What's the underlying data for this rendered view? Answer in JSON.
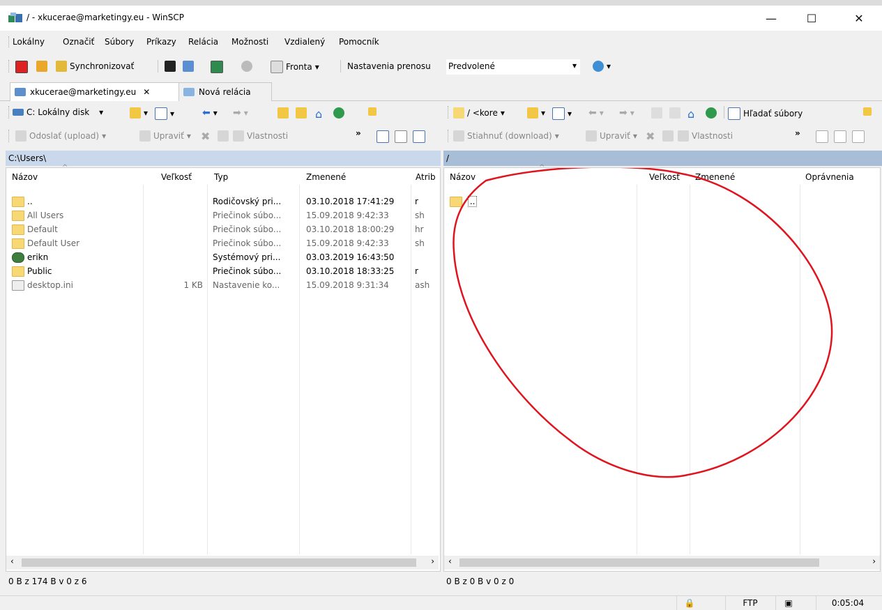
{
  "window": {
    "title": "/ - xkucerae@marketingy.eu - WinSCP",
    "minimize": "—",
    "maximize": "☐",
    "close": "✕"
  },
  "menu": [
    "Lokálny",
    "Označiť",
    "Súbory",
    "Príkazy",
    "Relácia",
    "Možnosti",
    "Vzdialený",
    "Pomocník"
  ],
  "toolbar": {
    "synchronize": "Synchronizovať",
    "queue": "Fronta",
    "transfer_label": "Nastavenia prenosu",
    "transfer_value": "Predvolené"
  },
  "tabs": [
    {
      "label": "xkucerae@marketingy.eu",
      "close": "✕"
    },
    {
      "label": "Nová relácia"
    }
  ],
  "local": {
    "drive": "C: Lokálny disk",
    "upload": "Odoslať (upload)",
    "edit": "Upraviť",
    "properties": "Vlastnosti",
    "path": "C:\\Users\\",
    "columns": [
      "Názov",
      "Veľkosť",
      "Typ",
      "Zmenené",
      "Atrib"
    ],
    "rows": [
      {
        "name": "..",
        "size": "",
        "type": "Rodičovský pri...",
        "changed": "03.10.2018 17:41:29",
        "attr": "r",
        "kind": "parent",
        "gray": false
      },
      {
        "name": "All Users",
        "size": "",
        "type": "Priečinok súbo...",
        "changed": "15.09.2018 9:42:33",
        "attr": "sh",
        "kind": "folder",
        "gray": true
      },
      {
        "name": "Default",
        "size": "",
        "type": "Priečinok súbo...",
        "changed": "03.10.2018 18:00:29",
        "attr": "hr",
        "kind": "folder",
        "gray": true
      },
      {
        "name": "Default User",
        "size": "",
        "type": "Priečinok súbo...",
        "changed": "15.09.2018 9:42:33",
        "attr": "sh",
        "kind": "folder",
        "gray": true
      },
      {
        "name": "erikn",
        "size": "",
        "type": "Systémový pri...",
        "changed": "03.03.2019 16:43:50",
        "attr": "",
        "kind": "user",
        "gray": false
      },
      {
        "name": "Public",
        "size": "",
        "type": "Priečinok súbo...",
        "changed": "03.10.2018 18:33:25",
        "attr": "r",
        "kind": "folder",
        "gray": false
      },
      {
        "name": "desktop.ini",
        "size": "1 KB",
        "type": "Nastavenie ko...",
        "changed": "15.09.2018 9:31:34",
        "attr": "ash",
        "kind": "file",
        "gray": true
      }
    ],
    "status": "0 B z 174 B v 0 z 6"
  },
  "remote": {
    "path_combo": "/ <kore",
    "find": "Hľadať súbory",
    "download": "Stiahnuť (download)",
    "edit": "Upraviť",
    "properties": "Vlastnosti",
    "path": "/",
    "columns": [
      "Názov",
      "Veľkosť",
      "Zmenené",
      "Oprávnenia"
    ],
    "rows": [
      {
        "name": ".."
      }
    ],
    "status": "0 B z 0 B v 0 z 0"
  },
  "statusbar": {
    "protocol": "FTP",
    "time": "0:05:04"
  },
  "colors": {
    "pathbar_local": "#c9d8ea",
    "pathbar_remote": "#a8bdd6",
    "annotation": "#e0141e"
  }
}
